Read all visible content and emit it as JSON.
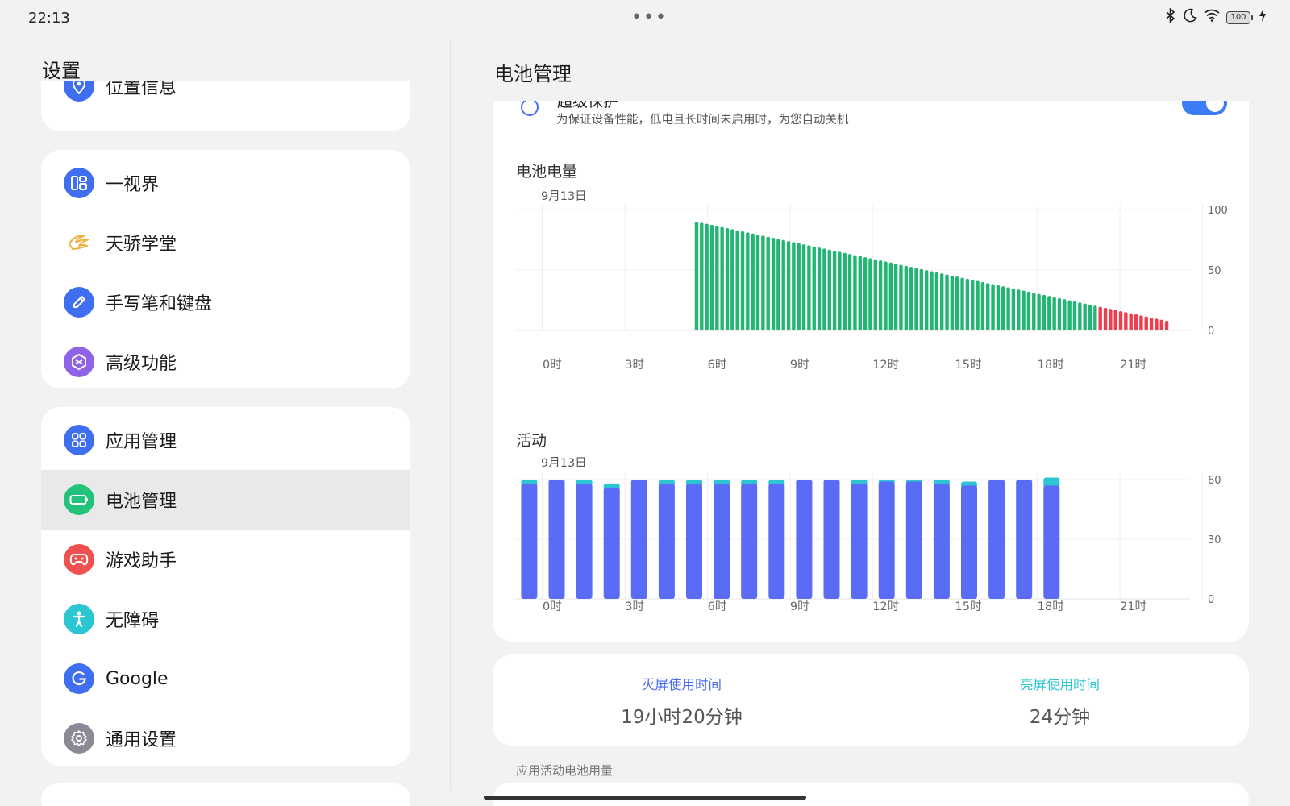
{
  "status_bar": {
    "time": "22:13",
    "dots": "•••",
    "battery_level": "100",
    "icons": [
      "bluetooth-icon",
      "moon-icon",
      "wifi-icon",
      "battery-icon",
      "charging-icon"
    ]
  },
  "left": {
    "title": "设置",
    "groups": [
      {
        "items": [
          {
            "label": "位置信息",
            "icon": "location-pin-icon",
            "color": "#3f6ef0"
          }
        ]
      },
      {
        "items": [
          {
            "label": "一视界",
            "icon": "split-view-icon",
            "color": "#3f6ef0"
          },
          {
            "label": "天骄学堂",
            "icon": "wings-icon",
            "color": "#f0b03c"
          },
          {
            "label": "手写笔和键盘",
            "icon": "pencil-icon",
            "color": "#3f6ef0"
          },
          {
            "label": "高级功能",
            "icon": "hexagon-icon",
            "color": "#8f63e8"
          }
        ]
      },
      {
        "items": [
          {
            "label": "应用管理",
            "icon": "grid-icon",
            "color": "#3f6ef0"
          },
          {
            "label": "电池管理",
            "icon": "battery-icon",
            "color": "#23c27a",
            "active": true
          },
          {
            "label": "游戏助手",
            "icon": "gamepad-icon",
            "color": "#ef5050"
          },
          {
            "label": "无障碍",
            "icon": "accessibility-icon",
            "color": "#2cc6d2"
          },
          {
            "label": "Google",
            "icon": "google-icon",
            "color": "#3f6ef0"
          },
          {
            "label": "通用设置",
            "icon": "gear-icon",
            "color": "#8a8a95"
          }
        ]
      }
    ]
  },
  "right": {
    "title": "电池管理",
    "protection": {
      "title": "超级保护",
      "description": "为保证设备性能，低电且长时间未启用时，为您自动关机",
      "enabled": true
    },
    "battery_chart_title": "电池电量",
    "activity_chart_title": "活动",
    "usage": {
      "screen_off_label": "灭屏使用时间",
      "screen_off_value": "19小时20分钟",
      "screen_off_color": "#4a6cf7",
      "screen_on_label": "亮屏使用时间",
      "screen_on_value": "24分钟",
      "screen_on_color": "#2cc6d2"
    },
    "app_usage_caption": "应用活动电池用量"
  },
  "chart_data": [
    {
      "type": "bar",
      "title": "电池电量",
      "date_label": "9月13日",
      "x_ticks": [
        "0时",
        "3时",
        "6时",
        "9时",
        "12时",
        "15时",
        "18时",
        "21时"
      ],
      "y_ticks": [
        "100",
        "50",
        "0"
      ],
      "ylim": [
        0,
        100
      ],
      "grid": true,
      "colors": {
        "normal": "#22b573",
        "low": "#ee3d4f"
      },
      "low_threshold": 20,
      "bars": {
        "start_hour": 5.6,
        "end_hour": 22.7,
        "count": 93,
        "start_value": 90,
        "end_value": 8
      }
    },
    {
      "type": "bar",
      "title": "活动",
      "date_label": "9月13日",
      "x_ticks": [
        "0时",
        "3时",
        "6时",
        "9时",
        "12时",
        "15时",
        "18时",
        "21时"
      ],
      "y_ticks": [
        "60",
        "30",
        "0"
      ],
      "ylim": [
        0,
        60
      ],
      "grid": true,
      "series": [
        {
          "name": "灭屏使用时间",
          "color": "#5a6cf5",
          "values": [
            58,
            60,
            58,
            56,
            60,
            58,
            58,
            58,
            58,
            58,
            60,
            60,
            58,
            59,
            59,
            58,
            57,
            60,
            60,
            57
          ]
        },
        {
          "name": "亮屏使用时间",
          "color": "#2cc6d2",
          "values": [
            2,
            0,
            2,
            2,
            0,
            2,
            2,
            2,
            2,
            2,
            0,
            0,
            2,
            1,
            1,
            2,
            2,
            0,
            0,
            4
          ]
        }
      ]
    }
  ]
}
